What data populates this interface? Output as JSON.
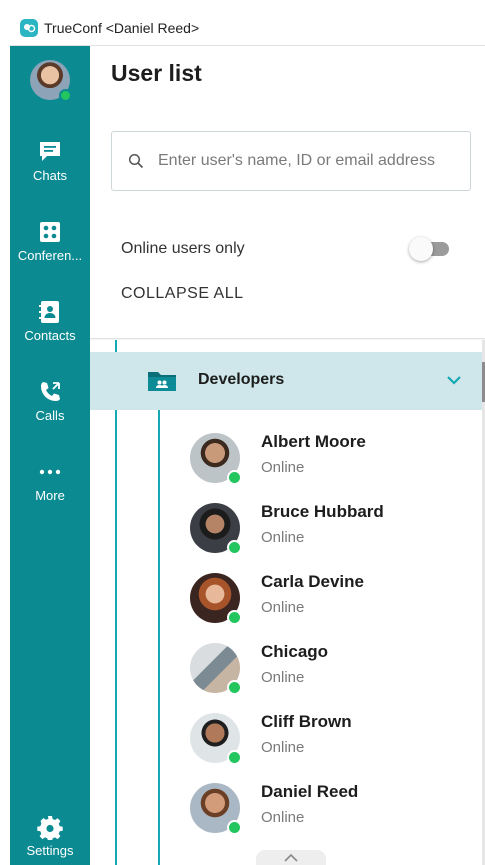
{
  "window": {
    "title": "TrueConf <Daniel Reed>"
  },
  "sidebar": {
    "items": [
      {
        "label": "Chats",
        "icon": "chat-icon"
      },
      {
        "label": "Conferen...",
        "icon": "conference-icon"
      },
      {
        "label": "Contacts",
        "icon": "contacts-icon"
      },
      {
        "label": "Calls",
        "icon": "calls-icon"
      },
      {
        "label": "More",
        "icon": "more-icon"
      }
    ],
    "settings_label": "Settings"
  },
  "main": {
    "title": "User list",
    "search": {
      "placeholder": "Enter user's name, ID or email address"
    },
    "online_only_label": "Online users only",
    "online_only_enabled": false,
    "collapse_all_label": "COLLAPSE ALL",
    "group": {
      "name": "Developers",
      "expanded": true
    },
    "contacts": [
      {
        "name": "Albert Moore",
        "status": "Online"
      },
      {
        "name": "Bruce Hubbard",
        "status": "Online"
      },
      {
        "name": "Carla Devine",
        "status": "Online"
      },
      {
        "name": "Chicago",
        "status": "Online"
      },
      {
        "name": "Cliff Brown",
        "status": "Online"
      },
      {
        "name": "Daniel Reed",
        "status": "Online"
      }
    ]
  },
  "colors": {
    "sidebar": "#0b8a92",
    "accent": "#16a8b4",
    "group_highlight": "#cfe7ea",
    "online": "#22c55e"
  }
}
